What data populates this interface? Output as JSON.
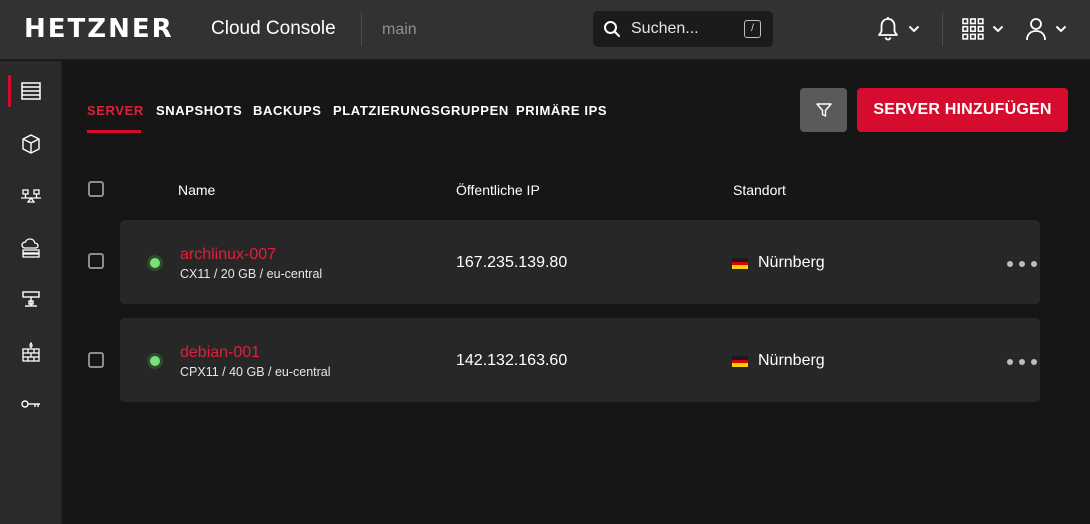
{
  "header": {
    "logo": "HETZNER",
    "product": "Cloud Console",
    "project": "main",
    "search_placeholder": "Suchen...",
    "search_shortcut": "/"
  },
  "sidebar": {
    "items": [
      {
        "icon": "server-icon",
        "active": true
      },
      {
        "icon": "volume-box-icon",
        "active": false
      },
      {
        "icon": "load-balancer-icon",
        "active": false
      },
      {
        "icon": "floating-ip-icon",
        "active": false
      },
      {
        "icon": "network-icon",
        "active": false
      },
      {
        "icon": "firewall-icon",
        "active": false
      },
      {
        "icon": "key-icon",
        "active": false
      }
    ]
  },
  "tabs": [
    {
      "label": "SERVER",
      "active": true
    },
    {
      "label": "SNAPSHOTS",
      "active": false
    },
    {
      "label": "BACKUPS",
      "active": false
    },
    {
      "label": "PLATZIERUNGSGRUPPEN",
      "active": false
    },
    {
      "label": "PRIMÄRE IPS",
      "active": false
    }
  ],
  "actions": {
    "add_server": "SERVER HINZUFÜGEN"
  },
  "table": {
    "columns": [
      "Name",
      "Öffentliche IP",
      "Standort"
    ],
    "rows": [
      {
        "name": "archlinux-007",
        "spec": "CX11 / 20 GB / eu-central",
        "ip": "167.235.139.80",
        "location": "Nürnberg",
        "status": "running"
      },
      {
        "name": "debian-001",
        "spec": "CPX11 / 40 GB / eu-central",
        "ip": "142.132.163.60",
        "location": "Nürnberg",
        "status": "running"
      }
    ]
  },
  "colors": {
    "accent": "#d50c2d",
    "status_running": "#7be075"
  }
}
